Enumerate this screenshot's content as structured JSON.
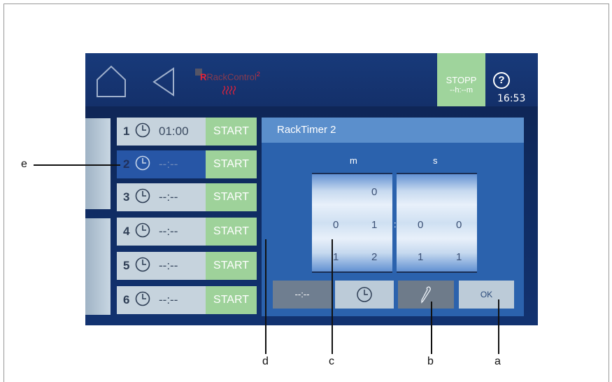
{
  "app": {
    "logo_text": "RackControl",
    "logo_superscript": "2",
    "heat_icon": "heating-waves-icon"
  },
  "topbar": {
    "home_icon": "home-icon",
    "back_icon": "back-arrow-icon",
    "stop_label": "STOPP",
    "stop_time": "--h:--m",
    "help_label": "?",
    "clock": "16:53"
  },
  "timers": [
    {
      "num": "1",
      "time": "01:00",
      "start_label": "START"
    },
    {
      "num": "2",
      "time": "--:--",
      "start_label": "START"
    },
    {
      "num": "3",
      "time": "--:--",
      "start_label": "START"
    },
    {
      "num": "4",
      "time": "--:--",
      "start_label": "START"
    },
    {
      "num": "5",
      "time": "--:--",
      "start_label": "START"
    },
    {
      "num": "6",
      "time": "--:--",
      "start_label": "START"
    }
  ],
  "dialog": {
    "title": "RackTimer 2",
    "minutes_header": "m",
    "seconds_header": "s",
    "minutes_rows": [
      [
        "",
        "0"
      ],
      [
        "0",
        "1"
      ],
      [
        "1",
        "2"
      ]
    ],
    "seconds_rows": [
      [
        "",
        ""
      ],
      [
        "0",
        "0"
      ],
      [
        "1",
        "1"
      ]
    ],
    "colon": ":",
    "clear_label": "--:--",
    "ok_label": "OK"
  },
  "callouts": {
    "a": "a",
    "b": "b",
    "c": "c",
    "d": "d",
    "e": "e"
  },
  "colors": {
    "green": "#9ed29a",
    "selected_row": "#2756a6",
    "dialog": "#2b62ad"
  }
}
